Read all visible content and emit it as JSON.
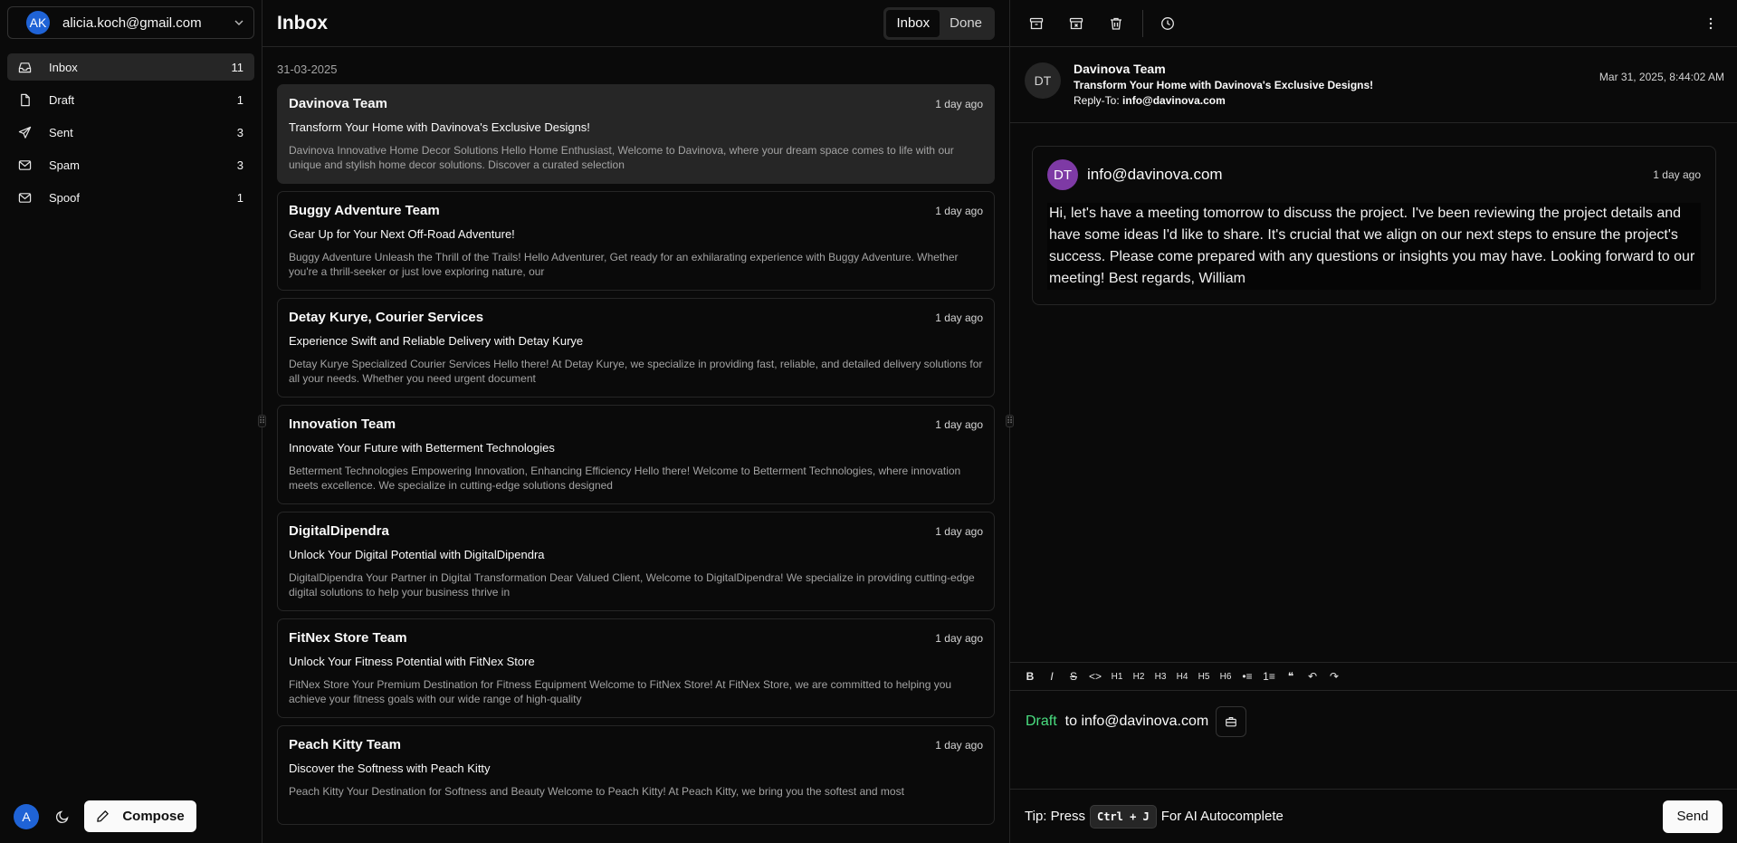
{
  "sidebar": {
    "account": {
      "initials": "AK",
      "email": "alicia.koch@gmail.com"
    },
    "items": [
      {
        "label": "Inbox",
        "count": "11",
        "icon": "inbox-icon"
      },
      {
        "label": "Draft",
        "count": "1",
        "icon": "file-icon"
      },
      {
        "label": "Sent",
        "count": "3",
        "icon": "send-icon"
      },
      {
        "label": "Spam",
        "count": "3",
        "icon": "mail-icon"
      },
      {
        "label": "Spoof",
        "count": "1",
        "icon": "mail-icon"
      }
    ],
    "user_initial": "A",
    "compose_label": "Compose"
  },
  "list": {
    "title": "Inbox",
    "tabs": [
      "Inbox",
      "Done"
    ],
    "date_group": "31-03-2025",
    "messages": [
      {
        "from": "Davinova Team",
        "time": "1 day ago",
        "subject": "Transform Your Home with Davinova's Exclusive Designs!",
        "preview": "Davinova Innovative Home Decor Solutions Hello Home Enthusiast, Welcome to Davinova, where your dream space comes to life with our unique and stylish home decor solutions. Discover a curated selection"
      },
      {
        "from": "Buggy Adventure Team",
        "time": "1 day ago",
        "subject": "Gear Up for Your Next Off-Road Adventure!",
        "preview": "Buggy Adventure Unleash the Thrill of the Trails! Hello Adventurer, Get ready for an exhilarating experience with Buggy Adventure. Whether you're a thrill-seeker or just love exploring nature, our"
      },
      {
        "from": "Detay Kurye, Courier Services",
        "time": "1 day ago",
        "subject": "Experience Swift and Reliable Delivery with Detay Kurye",
        "preview": "Detay Kurye Specialized Courier Services Hello there! At Detay Kurye, we specialize in providing fast, reliable, and detailed delivery solutions for all your needs. Whether you need urgent document"
      },
      {
        "from": "Innovation Team",
        "time": "1 day ago",
        "subject": "Innovate Your Future with Betterment Technologies",
        "preview": "Betterment Technologies Empowering Innovation, Enhancing Efficiency Hello there! Welcome to Betterment Technologies, where innovation meets excellence. We specialize in cutting-edge solutions designed"
      },
      {
        "from": "DigitalDipendra",
        "time": "1 day ago",
        "subject": "Unlock Your Digital Potential with DigitalDipendra",
        "preview": "DigitalDipendra Your Partner in Digital Transformation Dear Valued Client, Welcome to DigitalDipendra! We specialize in providing cutting-edge digital solutions to help your business thrive in"
      },
      {
        "from": "FitNex Store Team",
        "time": "1 day ago",
        "subject": "Unlock Your Fitness Potential with FitNex Store",
        "preview": "FitNex Store Your Premium Destination for Fitness Equipment Welcome to FitNex Store! At FitNex Store, we are committed to helping you achieve your fitness goals with our wide range of high-quality"
      },
      {
        "from": "Peach Kitty Team",
        "time": "1 day ago",
        "subject": "Discover the Softness with Peach Kitty",
        "preview": "Peach Kitty Your Destination for Softness and Beauty Welcome to Peach Kitty! At Peach Kitty, we bring you the softest and most"
      }
    ]
  },
  "reader": {
    "header": {
      "initials": "DT",
      "from": "Davinova Team",
      "subject": "Transform Your Home with Davinova's Exclusive Designs!",
      "reply_to_label": "Reply-To:",
      "reply_to": "info@davinova.com",
      "date": "Mar 31, 2025, 8:44:02 AM"
    },
    "card": {
      "initials": "DT",
      "from": "info@davinova.com",
      "time": "1 day ago",
      "body": "Hi, let's have a meeting tomorrow to discuss the project. I've been reviewing the project details and have some ideas I'd like to share. It's crucial that we align on our next steps to ensure the project's success. Please come prepared with any questions or insights you may have. Looking forward to our meeting! Best regards, William"
    },
    "editor_buttons": [
      "B",
      "I",
      "S",
      "<>",
      "H1",
      "H2",
      "H3",
      "H4",
      "H5",
      "H6",
      "•≡",
      "1≡",
      "❝",
      "↶",
      "↷"
    ],
    "draft": {
      "tag": "Draft",
      "to": "to info@davinova.com"
    },
    "tip": {
      "prefix": "Tip: Press",
      "kbd": "Ctrl + J",
      "suffix": "For AI Autocomplete"
    },
    "send_label": "Send"
  },
  "colors": {
    "background": "#0a0a0a",
    "accent_blue": "#1f63d6",
    "draft_green": "#4ade80",
    "avatar_purple": "#7e3aa5"
  }
}
